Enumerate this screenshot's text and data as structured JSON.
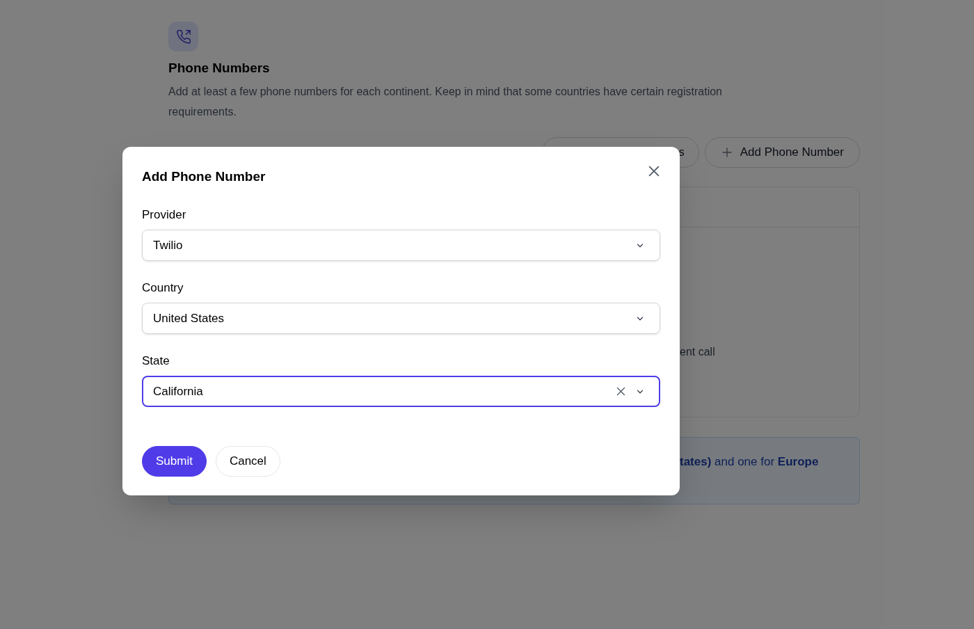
{
  "page": {
    "title": "Phone Numbers",
    "description": "Add at least a few phone numbers for each continent. Keep in mind that some countries have certain registration requirements.",
    "search_button": "s",
    "add_button": "Add Phone Number",
    "card_text": "ent call",
    "info_text": "**tates)** and one for **Europe**"
  },
  "modal": {
    "title": "Add Phone Number",
    "fields": [
      {
        "label": "Provider",
        "value": "Twilio",
        "focused": false,
        "clearable": false
      },
      {
        "label": "Country",
        "value": "United States",
        "focused": false,
        "clearable": false
      },
      {
        "label": "State",
        "value": "California",
        "focused": true,
        "clearable": true
      }
    ],
    "buttons": [
      {
        "label": "Submit",
        "kind": "primary"
      },
      {
        "label": "Cancel",
        "kind": "secondary"
      }
    ]
  }
}
